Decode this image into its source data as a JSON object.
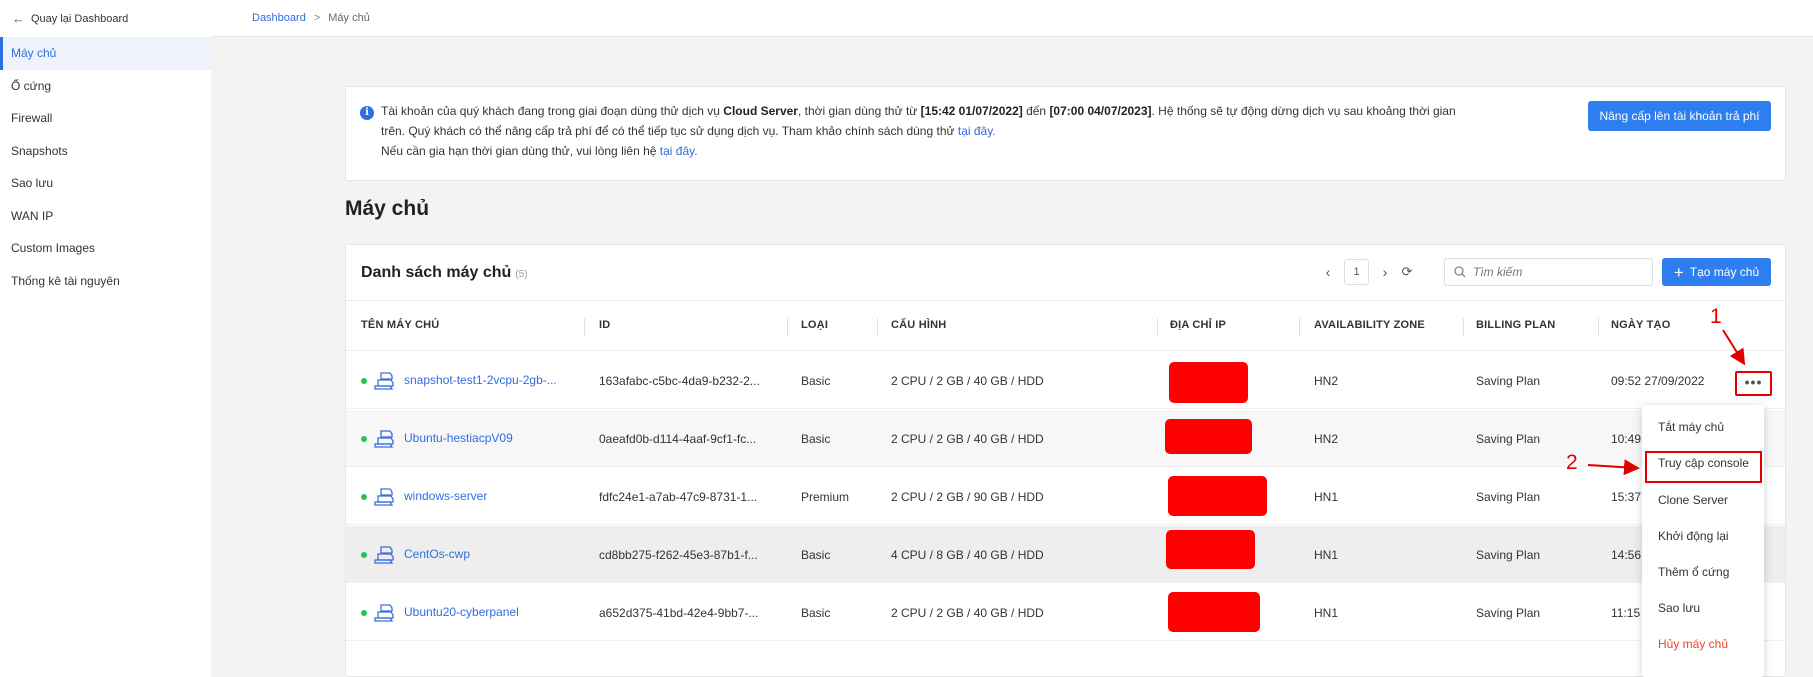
{
  "sidebar": {
    "back_label": "Quay lại Dashboard",
    "items": [
      {
        "label": "Máy chủ",
        "active": true
      },
      {
        "label": "Ổ cứng"
      },
      {
        "label": "Firewall"
      },
      {
        "label": "Snapshots"
      },
      {
        "label": "Sao lưu"
      },
      {
        "label": "WAN IP"
      },
      {
        "label": "Custom Images"
      },
      {
        "label": "Thống kê tài nguyên"
      }
    ]
  },
  "breadcrumb": {
    "root": "Dashboard",
    "separator": ">",
    "current": "Máy chủ"
  },
  "notice": {
    "text_1": "Tài khoản của quý khách đang trong giai đoạn dùng thử dịch vụ ",
    "service": "Cloud Server",
    "text_2": ", thời gian dùng thử từ ",
    "start": "[15:42 01/07/2022]",
    "text_3": " đến ",
    "end": "[07:00 04/07/2023]",
    "text_4": ". Hệ thống sẽ tự động dừng dịch vụ sau khoảng thời gian trên. Quý khách có thể nâng cấp trả phí để có thể tiếp tục sử dụng dịch vụ. Tham khảo chính sách dùng thử ",
    "link_1": "tại đây.",
    "text_5": "Nếu cần gia hạn thời gian dùng thử, vui lòng liên hệ ",
    "link_2": "tại đây.",
    "upgrade_button": "Nâng cấp lên tài khoản trả phí"
  },
  "page_title": "Máy chủ",
  "list": {
    "title": "Danh sách máy chủ",
    "count": "(5)",
    "page": "1",
    "search_placeholder": "Tìm kiếm",
    "create_button": "Tạo máy chủ",
    "columns": [
      "TÊN MÁY CHỦ",
      "ID",
      "LOẠI",
      "CẤU HÌNH",
      "ĐỊA CHỈ IP",
      "AVAILABILITY ZONE",
      "BILLING PLAN",
      "NGÀY TẠO"
    ],
    "rows": [
      {
        "name": "snapshot-test1-2vcpu-2gb-...",
        "id": "163afabc-c5bc-4da9-b232-2...",
        "type": "Basic",
        "config": "2 CPU / 2 GB / 40 GB / HDD",
        "zone": "HN2",
        "plan": "Saving Plan",
        "created": "09:52 27/09/2022"
      },
      {
        "name": "Ubuntu-hestiacpV09",
        "id": "0aeafd0b-d114-4aaf-9cf1-fc...",
        "type": "Basic",
        "config": "2 CPU / 2 GB / 40 GB / HDD",
        "zone": "HN2",
        "plan": "Saving Plan",
        "created": "10:49"
      },
      {
        "name": "windows-server",
        "id": "fdfc24e1-a7ab-47c9-8731-1...",
        "type": "Premium",
        "config": "2 CPU / 2 GB / 90 GB / HDD",
        "zone": "HN1",
        "plan": "Saving Plan",
        "created": "15:37"
      },
      {
        "name": "CentOs-cwp",
        "id": "cd8bb275-f262-45e3-87b1-f...",
        "type": "Basic",
        "config": "4 CPU / 8 GB / 40 GB / HDD",
        "zone": "HN1",
        "plan": "Saving Plan",
        "created": "14:56"
      },
      {
        "name": "Ubuntu20-cyberpanel",
        "id": "a652d375-41bd-42e4-9bb7-...",
        "type": "Basic",
        "config": "2 CPU / 2 GB / 40 GB / HDD",
        "zone": "HN1",
        "plan": "Saving Plan",
        "created": "11:15"
      }
    ]
  },
  "more_button": "•••",
  "action_menu": [
    "Tắt máy chủ",
    "Truy cập console",
    "Clone Server",
    "Khởi động lại",
    "Thêm ổ cứng",
    "Sao lưu",
    "Hủy máy chủ"
  ],
  "annotations": {
    "step_1": "1",
    "step_2": "2"
  },
  "colors": {
    "accent": "#2f7ef0",
    "link": "#2f6de0",
    "status_running": "#2cc24a",
    "annotation_red": "#e00000",
    "danger": "#e8462c"
  }
}
